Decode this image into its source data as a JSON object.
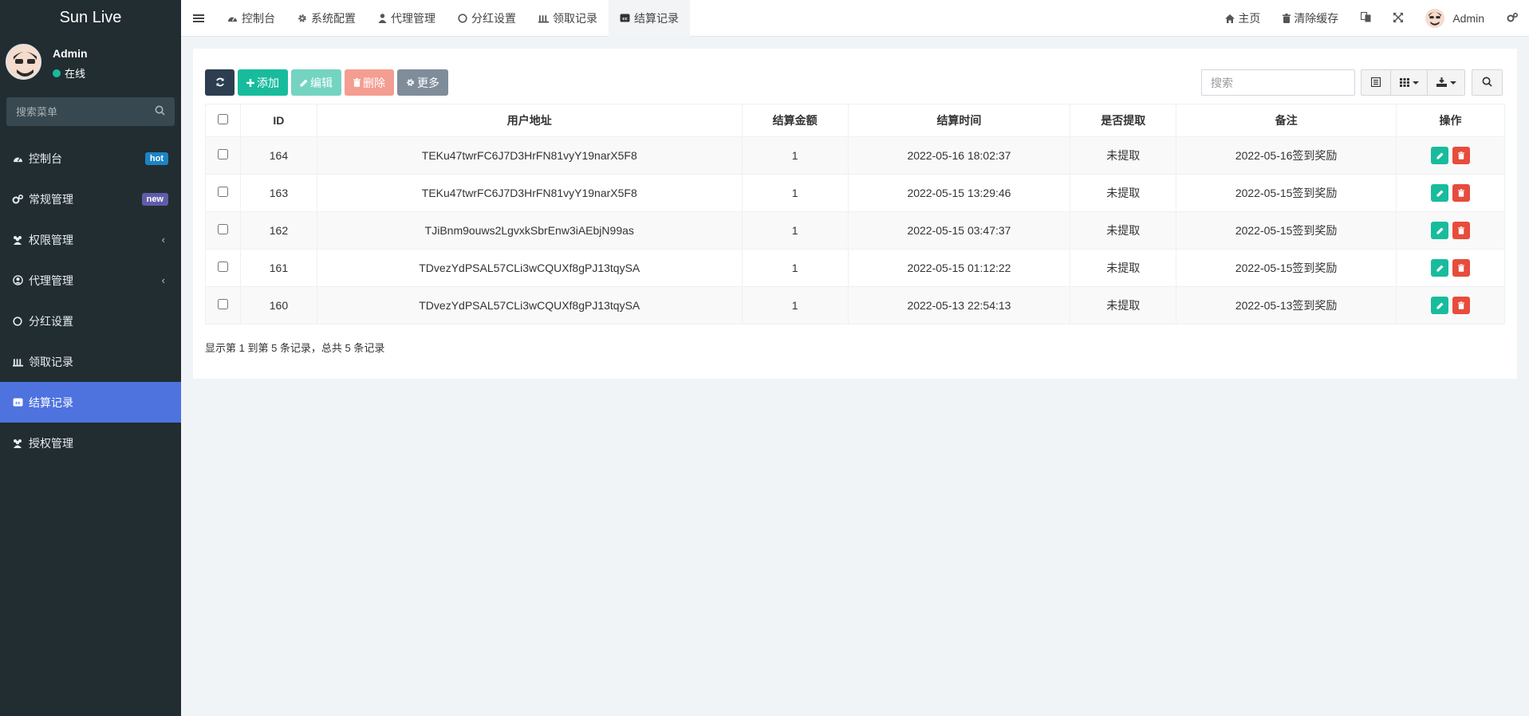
{
  "brand": "Sun Live",
  "user": {
    "name": "Admin",
    "status": "在线"
  },
  "sidebar": {
    "search_placeholder": "搜索菜单",
    "items": [
      {
        "label": "控制台",
        "icon": "dashboard-icon",
        "badge": "hot"
      },
      {
        "label": "常规管理",
        "icon": "cogs-icon",
        "badge": "new"
      },
      {
        "label": "权限管理",
        "icon": "group-icon",
        "chevron": true
      },
      {
        "label": "代理管理",
        "icon": "user-circle-icon",
        "chevron": true
      },
      {
        "label": "分红设置",
        "icon": "circle-icon"
      },
      {
        "label": "领取记录",
        "icon": "bar-icon"
      },
      {
        "label": "结算记录",
        "icon": "cc-icon",
        "active": true
      },
      {
        "label": "授权管理",
        "icon": "group-icon"
      }
    ]
  },
  "topbar": {
    "tabs": [
      {
        "label": "控制台",
        "icon": "dashboard-icon"
      },
      {
        "label": "系统配置",
        "icon": "gear-icon"
      },
      {
        "label": "代理管理",
        "icon": "user-icon"
      },
      {
        "label": "分红设置",
        "icon": "circle-icon"
      },
      {
        "label": "领取记录",
        "icon": "bar-icon"
      },
      {
        "label": "结算记录",
        "icon": "cc-icon",
        "active": true
      }
    ],
    "right": {
      "home": "主页",
      "clear_cache": "清除缓存",
      "admin": "Admin"
    }
  },
  "toolbar": {
    "add": "添加",
    "edit": "编辑",
    "delete": "删除",
    "more": "更多",
    "search_placeholder": "搜索"
  },
  "table": {
    "columns": [
      "ID",
      "用户地址",
      "结算金额",
      "结算时间",
      "是否提取",
      "备注",
      "操作"
    ],
    "rows": [
      {
        "id": "164",
        "address": "TEKu47twrFC6J7D3HrFN81vyY19narX5F8",
        "amount": "1",
        "time": "2022-05-16 18:02:37",
        "status": "未提取",
        "note": "2022-05-16签到奖励"
      },
      {
        "id": "163",
        "address": "TEKu47twrFC6J7D3HrFN81vyY19narX5F8",
        "amount": "1",
        "time": "2022-05-15 13:29:46",
        "status": "未提取",
        "note": "2022-05-15签到奖励"
      },
      {
        "id": "162",
        "address": "TJiBnm9ouws2LgvxkSbrEnw3iAEbjN99as",
        "amount": "1",
        "time": "2022-05-15 03:47:37",
        "status": "未提取",
        "note": "2022-05-15签到奖励"
      },
      {
        "id": "161",
        "address": "TDvezYdPSAL57CLi3wCQUXf8gPJ13tqySA",
        "amount": "1",
        "time": "2022-05-15 01:12:22",
        "status": "未提取",
        "note": "2022-05-15签到奖励"
      },
      {
        "id": "160",
        "address": "TDvezYdPSAL57CLi3wCQUXf8gPJ13tqySA",
        "amount": "1",
        "time": "2022-05-13 22:54:13",
        "status": "未提取",
        "note": "2022-05-13签到奖励"
      }
    ]
  },
  "pagination": {
    "summary": "显示第 1 到第 5 条记录，总共 5 条记录"
  },
  "colors": {
    "sidebar_bg": "#222d32",
    "active": "#4e73df",
    "success": "#18bc9c",
    "danger": "#e74c3c"
  }
}
